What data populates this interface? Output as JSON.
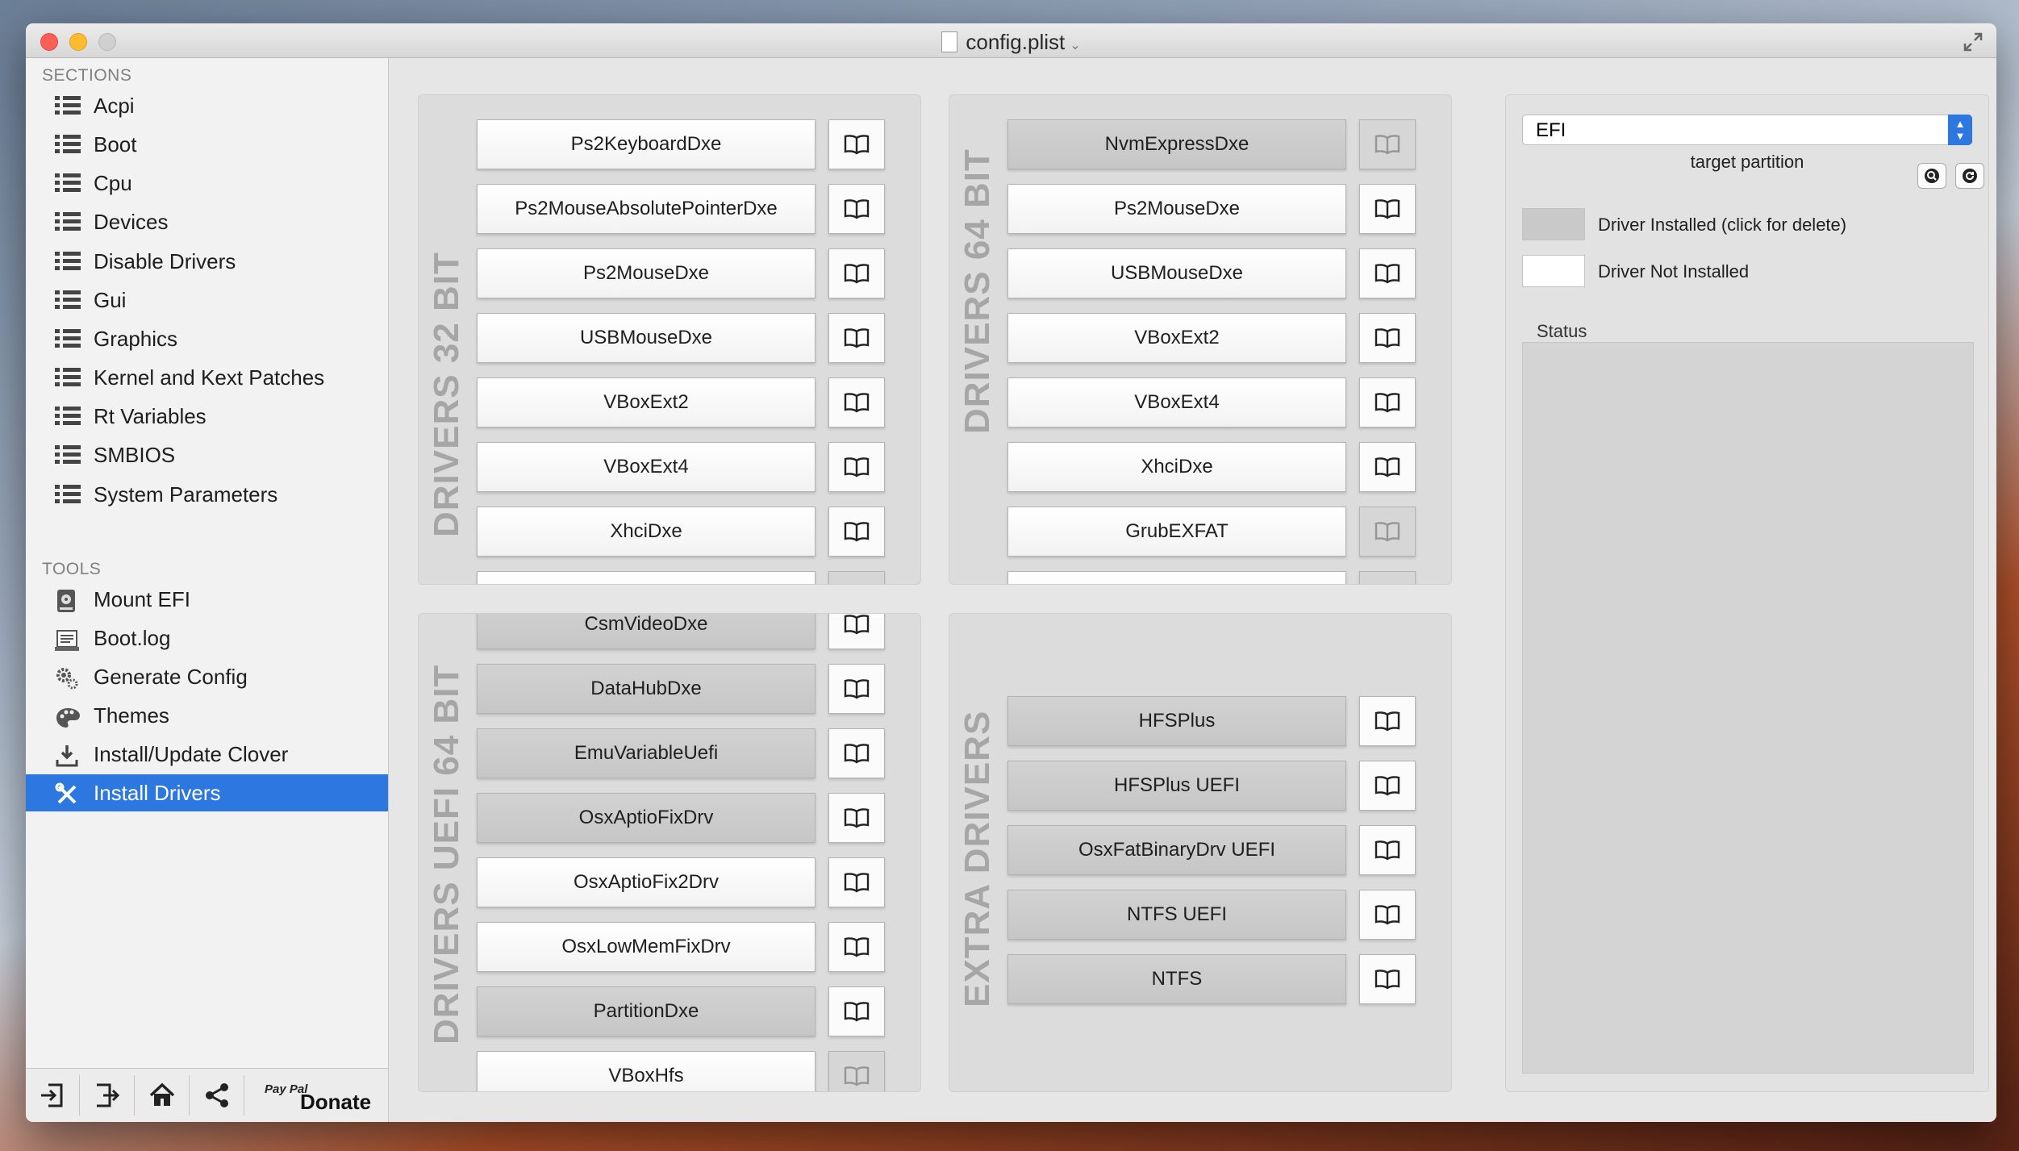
{
  "window": {
    "title": "config.plist"
  },
  "sidebar": {
    "sections_header": "SECTIONS",
    "sections": [
      "Acpi",
      "Boot",
      "Cpu",
      "Devices",
      "Disable Drivers",
      "Gui",
      "Graphics",
      "Kernel and Kext Patches",
      "Rt Variables",
      "SMBIOS",
      "System Parameters"
    ],
    "tools_header": "TOOLS",
    "tools": [
      {
        "label": "Mount EFI",
        "icon": "disk-icon"
      },
      {
        "label": "Boot.log",
        "icon": "log-icon"
      },
      {
        "label": "Generate Config",
        "icon": "gears-icon"
      },
      {
        "label": "Themes",
        "icon": "palette-icon"
      },
      {
        "label": "Install/Update Clover",
        "icon": "download-icon"
      },
      {
        "label": "Install Drivers",
        "icon": "tools-icon",
        "active": true
      }
    ],
    "bottom": {
      "paypal": "Pay Pal",
      "donate": "Donate"
    }
  },
  "panels": {
    "drivers32": {
      "title": "DRIVERS 32 BIT",
      "items": [
        {
          "name": "Ps2KeyboardDxe",
          "installed": false,
          "doc": true
        },
        {
          "name": "Ps2MouseAbsolutePointerDxe",
          "installed": false,
          "doc": true
        },
        {
          "name": "Ps2MouseDxe",
          "installed": false,
          "doc": true
        },
        {
          "name": "USBMouseDxe",
          "installed": false,
          "doc": true
        },
        {
          "name": "VBoxExt2",
          "installed": false,
          "doc": true
        },
        {
          "name": "VBoxExt4",
          "installed": false,
          "doc": true
        },
        {
          "name": "XhciDxe",
          "installed": false,
          "doc": true
        }
      ]
    },
    "drivers64": {
      "title": "DRIVERS 64 BIT",
      "items": [
        {
          "name": "NvmExpressDxe",
          "installed": true,
          "doc": false
        },
        {
          "name": "Ps2MouseDxe",
          "installed": false,
          "doc": true
        },
        {
          "name": "USBMouseDxe",
          "installed": false,
          "doc": true
        },
        {
          "name": "VBoxExt2",
          "installed": false,
          "doc": true
        },
        {
          "name": "VBoxExt4",
          "installed": false,
          "doc": true
        },
        {
          "name": "XhciDxe",
          "installed": false,
          "doc": true
        },
        {
          "name": "GrubEXFAT",
          "installed": false,
          "doc": false
        }
      ]
    },
    "uefi64": {
      "title": "DRIVERS UEFI 64 BIT",
      "items": [
        {
          "name": "CsmVideoDxe",
          "installed": true,
          "doc": true
        },
        {
          "name": "DataHubDxe",
          "installed": true,
          "doc": true
        },
        {
          "name": "EmuVariableUefi",
          "installed": true,
          "doc": true
        },
        {
          "name": "OsxAptioFixDrv",
          "installed": true,
          "doc": true
        },
        {
          "name": "OsxAptioFix2Drv",
          "installed": false,
          "doc": true
        },
        {
          "name": "OsxLowMemFixDrv",
          "installed": false,
          "doc": true
        },
        {
          "name": "PartitionDxe",
          "installed": true,
          "doc": true
        },
        {
          "name": "VBoxHfs",
          "installed": false,
          "doc": false
        }
      ]
    },
    "extra": {
      "title": "EXTRA DRIVERS",
      "items": [
        {
          "name": "HFSPlus",
          "installed": true,
          "doc": true
        },
        {
          "name": "HFSPlus UEFI",
          "installed": true,
          "doc": true
        },
        {
          "name": "OsxFatBinaryDrv UEFI",
          "installed": true,
          "doc": true
        },
        {
          "name": "NTFS UEFI",
          "installed": true,
          "doc": true
        },
        {
          "name": "NTFS",
          "installed": true,
          "doc": true
        }
      ]
    }
  },
  "right": {
    "partition_value": "EFI",
    "target_caption": "target partition",
    "legend_installed": "Driver Installed (click for delete)",
    "legend_not_installed": "Driver Not Installed",
    "status_label": "Status",
    "colors": {
      "installed": "#c9c9c9",
      "not_installed": "#ffffff",
      "accent": "#2c78e0"
    }
  }
}
